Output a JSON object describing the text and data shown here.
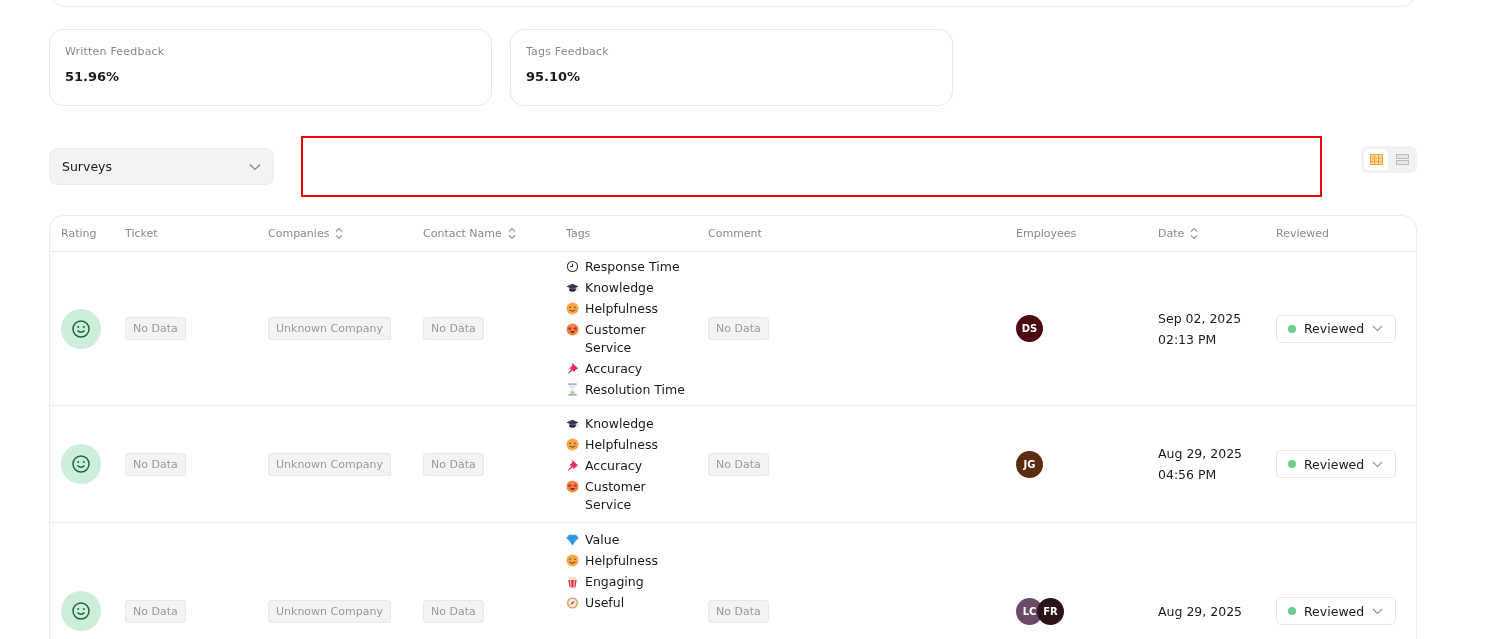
{
  "stats": [
    {
      "label": "Written Feedback",
      "value": "51.96%"
    },
    {
      "label": "Tags Feedback",
      "value": "95.10%"
    }
  ],
  "source_select": {
    "value": "Surveys"
  },
  "view_toggle": [
    {
      "kind": "grid",
      "selected": true
    },
    {
      "kind": "rows",
      "selected": false
    }
  ],
  "table": {
    "columns": [
      {
        "label": "Rating",
        "sortable": false
      },
      {
        "label": "Ticket",
        "sortable": false
      },
      {
        "label": "Companies",
        "sortable": true
      },
      {
        "label": "Contact Name",
        "sortable": true
      },
      {
        "label": "Tags",
        "sortable": false
      },
      {
        "label": "Comment",
        "sortable": false
      },
      {
        "label": "Employees",
        "sortable": false
      },
      {
        "label": "Date",
        "sortable": true
      },
      {
        "label": "Reviewed",
        "sortable": false
      }
    ],
    "rows": [
      {
        "ticket": "No Data",
        "company": "Unknown Company",
        "contact": "No Data",
        "tags": [
          {
            "kind": "clock",
            "label": "Response Time"
          },
          {
            "kind": "cap",
            "label": "Knowledge"
          },
          {
            "kind": "smile",
            "label": "Helpfulness"
          },
          {
            "kind": "stareyes",
            "label": "Customer Service"
          },
          {
            "kind": "pin",
            "label": "Accuracy"
          },
          {
            "kind": "hourglass",
            "label": "Resolution Time"
          }
        ],
        "comment": "No Data",
        "employees": [
          {
            "initials": "DS",
            "color": "#4d0a10"
          }
        ],
        "date": "Sep 02, 2025",
        "time": "02:13 PM",
        "status": "Reviewed"
      },
      {
        "ticket": "No Data",
        "company": "Unknown Company",
        "contact": "No Data",
        "tags": [
          {
            "kind": "cap",
            "label": "Knowledge"
          },
          {
            "kind": "smile",
            "label": "Helpfulness"
          },
          {
            "kind": "pin",
            "label": "Accuracy"
          },
          {
            "kind": "stareyes",
            "label": "Customer Service"
          }
        ],
        "comment": "No Data",
        "employees": [
          {
            "initials": "JG",
            "color": "#5a2d12"
          }
        ],
        "date": "Aug 29, 2025",
        "time": "04:56 PM",
        "status": "Reviewed"
      },
      {
        "ticket": "No Data",
        "company": "Unknown Company",
        "contact": "No Data",
        "tags": [
          {
            "kind": "gem",
            "label": "Value"
          },
          {
            "kind": "smile",
            "label": "Helpfulness"
          },
          {
            "kind": "popcorn",
            "label": "Engaging"
          },
          {
            "kind": "compass",
            "label": "Useful"
          }
        ],
        "comment": "No Data",
        "employees": [
          {
            "initials": "LC",
            "color": "#6b4a66"
          },
          {
            "initials": "FR",
            "color": "#2a1418"
          }
        ],
        "date": "Aug 29, 2025",
        "status": "Reviewed"
      }
    ]
  }
}
